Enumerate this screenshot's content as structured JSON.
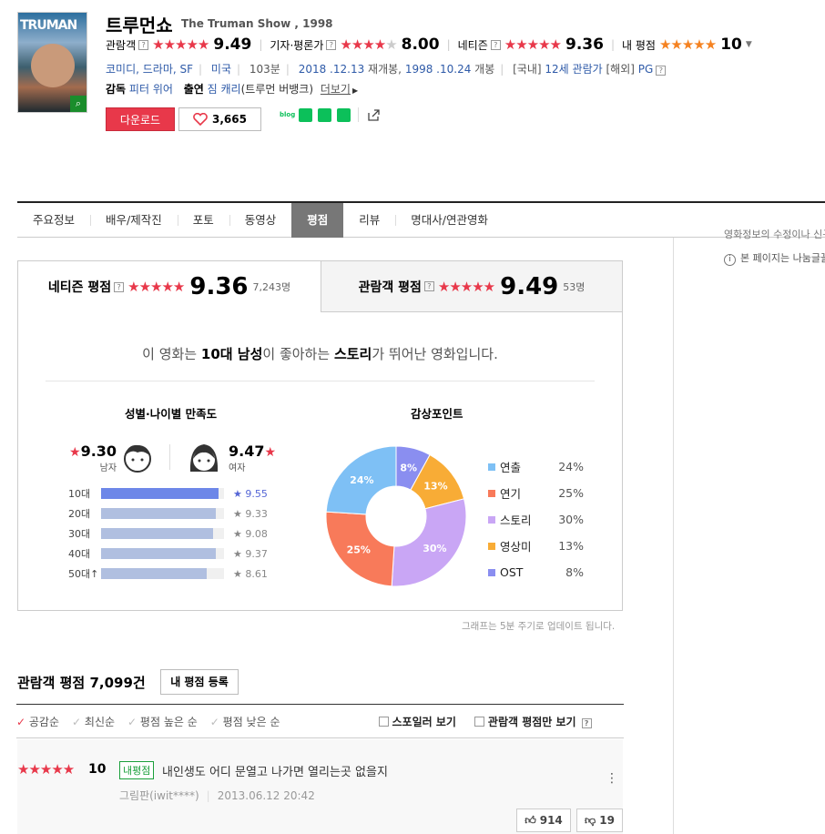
{
  "movie": {
    "title": "트루먼쇼",
    "en_title": "The Truman Show , 1998",
    "poster_text": "TRUMAN"
  },
  "ratings": [
    {
      "label": "관람객",
      "score": "9.49",
      "stars": "★★★★★"
    },
    {
      "label": "기자·평론가",
      "score": "8.00",
      "stars": "★★★★",
      "stars_off": "★"
    },
    {
      "label": "네티즌",
      "score": "9.36",
      "stars": "★★★★★"
    },
    {
      "label": "내 평점",
      "score": "10",
      "stars": "★★★★★"
    }
  ],
  "info": {
    "genre": "코미디, 드라마, SF",
    "country": "미국",
    "runtime": "103분",
    "release1": "2018 .12.13",
    "release1_suffix": " 재개봉, ",
    "release2": "1998 .10.24",
    "release2_suffix": " 개봉",
    "grade_kr_label": "[국내]",
    "grade_kr": "12세 관람가",
    "grade_ov_label": "[해외]",
    "grade_ov": "PG"
  },
  "credits": {
    "director_label": "감독",
    "director": "피터 위어",
    "cast_label": "출연",
    "cast": "짐 캐리",
    "cast_role": "(트루먼 버뱅크)",
    "more": "더보기"
  },
  "actions": {
    "download": "다운로드",
    "likes": "3,665"
  },
  "tabs": [
    "주요정보",
    "배우/제작진",
    "포토",
    "동영상",
    "평점",
    "리뷰",
    "명대사/연관영화"
  ],
  "side": {
    "notice": "영화정보의 수정이나 신규",
    "notice2": "본 페이지는 나눔글꼴"
  },
  "rating_tabs": {
    "netizen": {
      "label": "네티즌 평점",
      "score": "9.36",
      "count": "7,243명"
    },
    "audience": {
      "label": "관람객 평점",
      "score": "9.49",
      "count": "53명"
    }
  },
  "summary": {
    "pre": "이 영화는 ",
    "seg1": "10대 남성",
    "mid": "이 좋아하는 ",
    "seg2": "스토리",
    "post": "가 뛰어난 영화입니다."
  },
  "gender_section": {
    "title": "성별·나이별 만족도",
    "male_score": "9.30",
    "male_label": "남자",
    "female_score": "9.47",
    "female_label": "여자",
    "ages": [
      {
        "label": "10대",
        "value": "9.55",
        "frac": 0.955,
        "hi": true
      },
      {
        "label": "20대",
        "value": "9.33",
        "frac": 0.933
      },
      {
        "label": "30대",
        "value": "9.08",
        "frac": 0.908
      },
      {
        "label": "40대",
        "value": "9.37",
        "frac": 0.937
      },
      {
        "label": "50대↑",
        "value": "8.61",
        "frac": 0.861
      }
    ]
  },
  "points_section": {
    "title": "감상포인트"
  },
  "chart_data": {
    "type": "pie",
    "title": "감상포인트",
    "donut": true,
    "categories": [
      "연출",
      "연기",
      "스토리",
      "영상미",
      "OST"
    ],
    "values": [
      24,
      25,
      30,
      13,
      8
    ],
    "colors": [
      "#7ec0f5",
      "#f87a5a",
      "#c9a6f5",
      "#f8ac36",
      "#8a8ef0"
    ]
  },
  "graph_note": "그래프는 5분 주기로 업데이트 됩니다.",
  "audience": {
    "header": "관람객 평점 7,099건",
    "register": "내 평점 등록",
    "sorts": [
      "공감순",
      "최신순",
      "평점 높은 순",
      "평점 낮은 순"
    ],
    "spoiler": "스포일러 보기",
    "audience_only": "관람객 평점만 보기"
  },
  "review": {
    "stars": "★★★★★",
    "score": "10",
    "badge": "내평점",
    "text": "내인생도 어디 문열고 나가면 열리는곳 없을지",
    "user": "그림판(iwit****)",
    "date": "2013.06.12 20:42",
    "up": "914",
    "down": "19"
  }
}
